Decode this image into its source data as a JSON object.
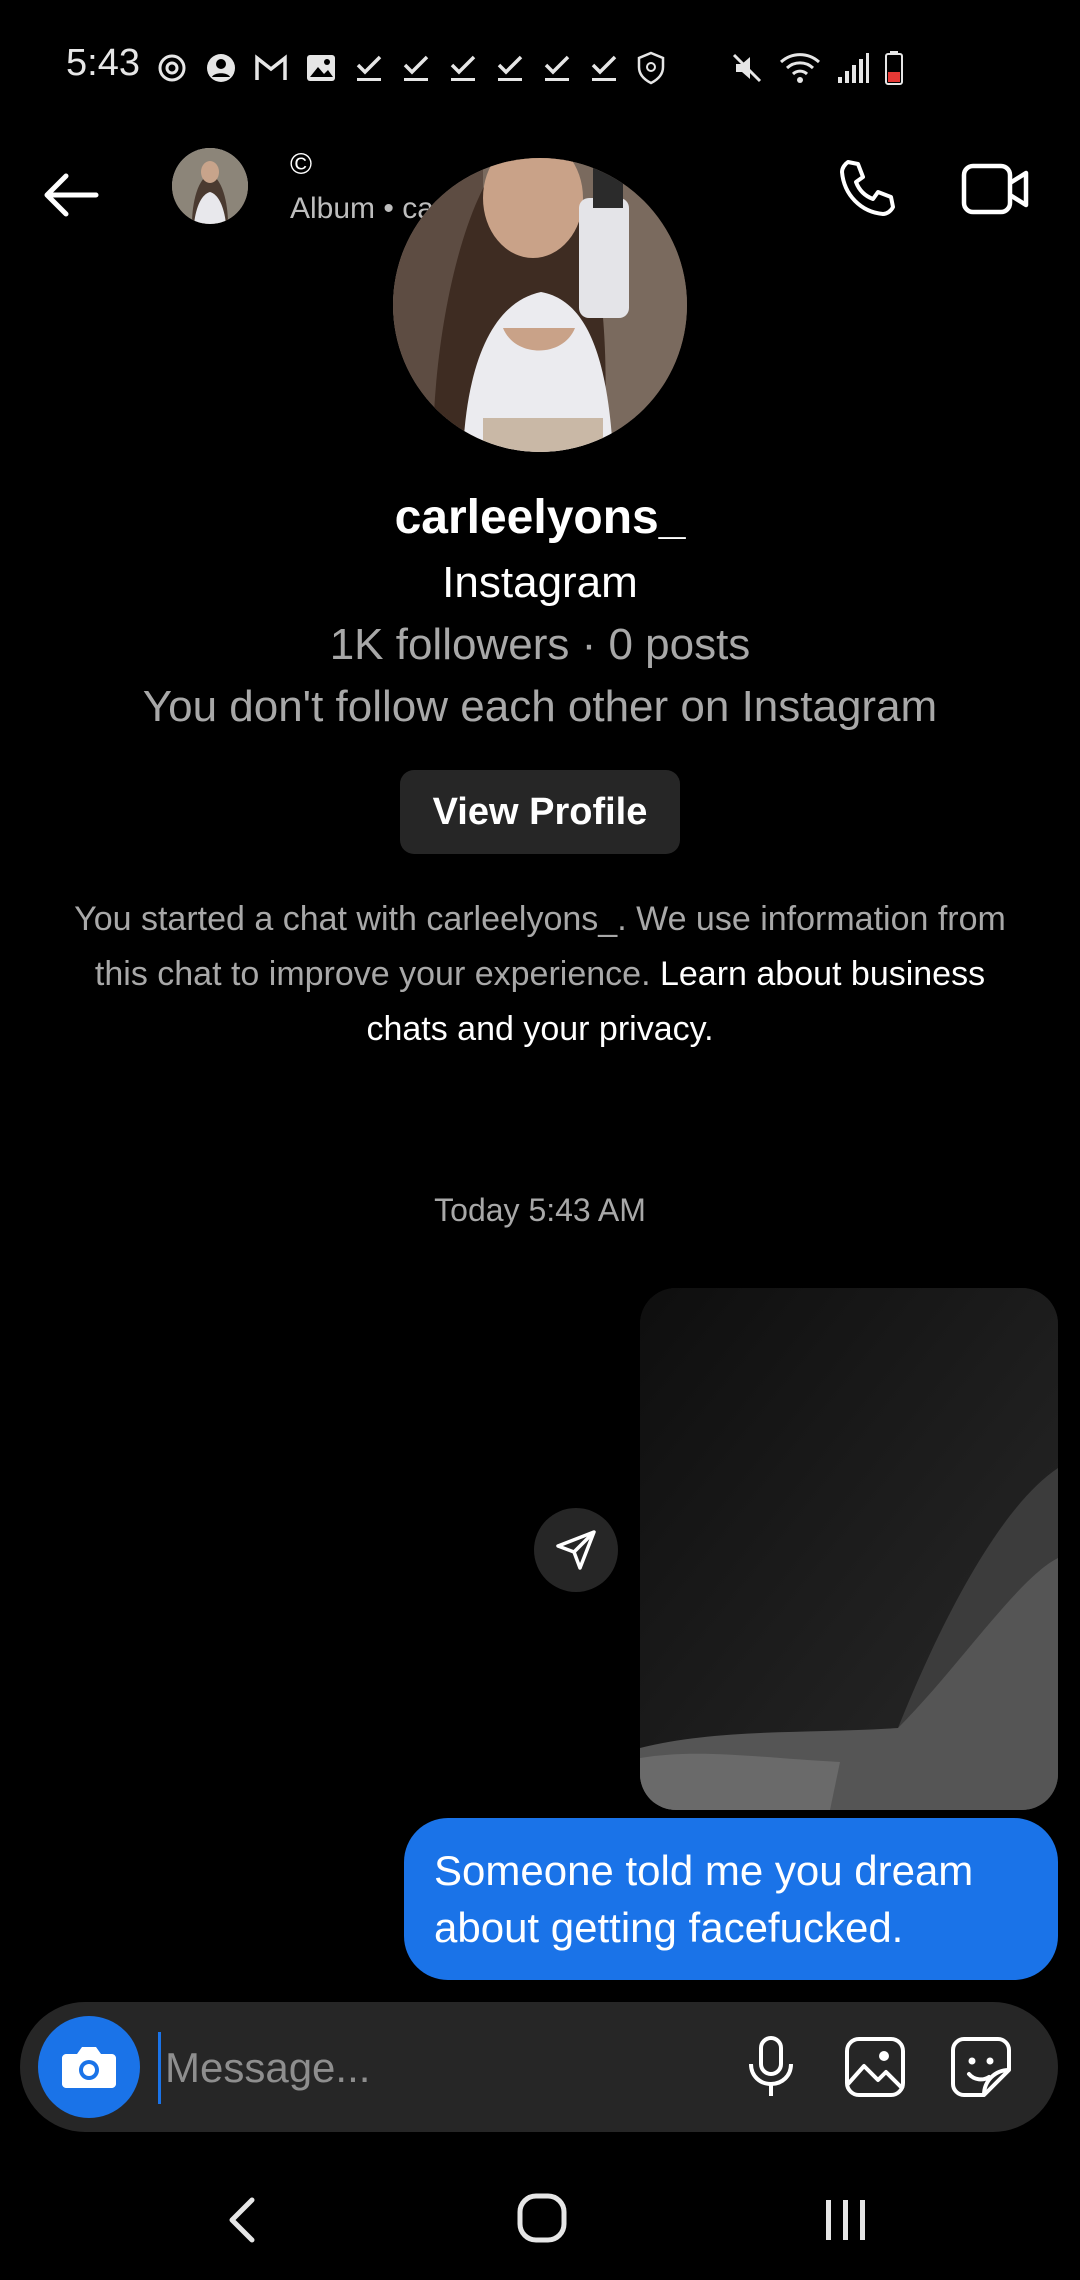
{
  "status_bar": {
    "time": "5:43",
    "left_icons": [
      "sync-icon",
      "account-icon",
      "gmail-icon",
      "gallery-icon",
      "check-icon",
      "check-icon",
      "check-icon",
      "check-icon",
      "check-icon",
      "check-icon",
      "shield-icon"
    ],
    "right_icons": [
      "mute-icon",
      "wifi-icon",
      "signal-icon",
      "battery-low-icon"
    ],
    "battery_color": "#e53935"
  },
  "header": {
    "title": "©",
    "subtitle": "Album • carleelyons_",
    "icons": [
      "back-arrow-icon",
      "phone-icon",
      "video-camera-icon"
    ]
  },
  "profile": {
    "username": "carleelyons_",
    "platform": "Instagram",
    "stats": "1K followers · 0 posts",
    "follow_status": "You don't follow each other on Instagram",
    "view_profile_label": "View Profile"
  },
  "privacy_note": {
    "text": "You started a chat with carleelyons_. We use information from this chat to improve your experience. ",
    "link": "Learn about business chats and your privacy."
  },
  "conversation": {
    "timestamp": "Today 5:43 AM",
    "messages": [
      {
        "type": "media",
        "from": "me",
        "description_icon": "photo-attachment"
      },
      {
        "type": "text",
        "from": "me",
        "text": "Someone told me you dream about getting facefucked."
      }
    ]
  },
  "composer": {
    "placeholder": "Message...",
    "value": "",
    "icons": [
      "camera-icon",
      "microphone-icon",
      "gallery-icon",
      "sticker-icon"
    ]
  },
  "nav_bar": {
    "icons": [
      "nav-back-icon",
      "nav-home-icon",
      "nav-recents-icon"
    ]
  },
  "colors": {
    "background": "#000000",
    "accent_blue": "#1a73e8",
    "surface": "#262626",
    "secondary_text": "#a8a8a8"
  }
}
